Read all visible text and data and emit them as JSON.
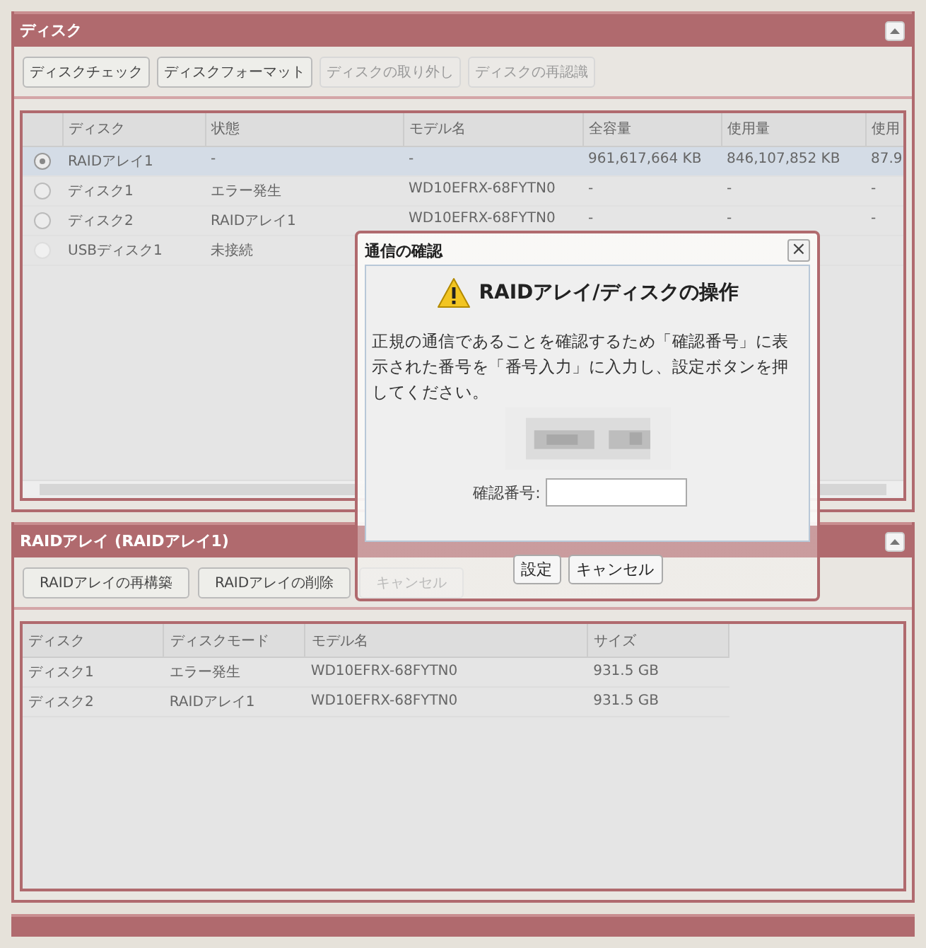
{
  "disk_panel": {
    "title": "ディスク",
    "buttons": [
      {
        "label": "ディスクチェック",
        "disabled": false
      },
      {
        "label": "ディスクフォーマット",
        "disabled": false
      },
      {
        "label": "ディスクの取り外し",
        "disabled": true
      },
      {
        "label": "ディスクの再認識",
        "disabled": true
      }
    ],
    "table": {
      "columns": [
        "ディスク",
        "状態",
        "モデル名",
        "全容量",
        "使用量",
        "使用"
      ],
      "rows": [
        {
          "selected": true,
          "disabled": false,
          "cells": [
            "RAIDアレイ1",
            "-",
            "-",
            "961,617,664 KB",
            "846,107,852 KB",
            "87.9"
          ]
        },
        {
          "selected": false,
          "disabled": false,
          "cells": [
            "ディスク1",
            "エラー発生",
            "WD10EFRX-68FYTN0",
            "-",
            "-",
            "-"
          ]
        },
        {
          "selected": false,
          "disabled": false,
          "cells": [
            "ディスク2",
            "RAIDアレイ1",
            "WD10EFRX-68FYTN0",
            "-",
            "-",
            "-"
          ]
        },
        {
          "selected": false,
          "disabled": true,
          "cells": [
            "USBディスク1",
            "未接続"
          ]
        }
      ]
    }
  },
  "raid_panel": {
    "title": "RAIDアレイ (RAIDアレイ1)",
    "buttons": [
      {
        "label": "RAIDアレイの再構築",
        "disabled": false
      },
      {
        "label": "RAIDアレイの削除",
        "disabled": false
      },
      {
        "label": "キャンセル",
        "disabled": true
      }
    ],
    "table": {
      "columns": [
        "ディスク",
        "ディスクモード",
        "モデル名",
        "サイズ"
      ],
      "rows": [
        {
          "cells": [
            "ディスク1",
            "エラー発生",
            "WD10EFRX-68FYTN0",
            "931.5 GB"
          ]
        },
        {
          "cells": [
            "ディスク2",
            "RAIDアレイ1",
            "WD10EFRX-68FYTN0",
            "931.5 GB"
          ]
        }
      ]
    }
  },
  "dialog": {
    "title": "通信の確認",
    "close": "×",
    "heading": "RAIDアレイ/ディスクの操作",
    "message": "正規の通信であることを確認するため「確認番号」に表示された番号を「番号入力」に入力し、設定ボタンを押してください。",
    "field_label": "確認番号:",
    "buttons": [
      "設定",
      "キャンセル"
    ]
  }
}
